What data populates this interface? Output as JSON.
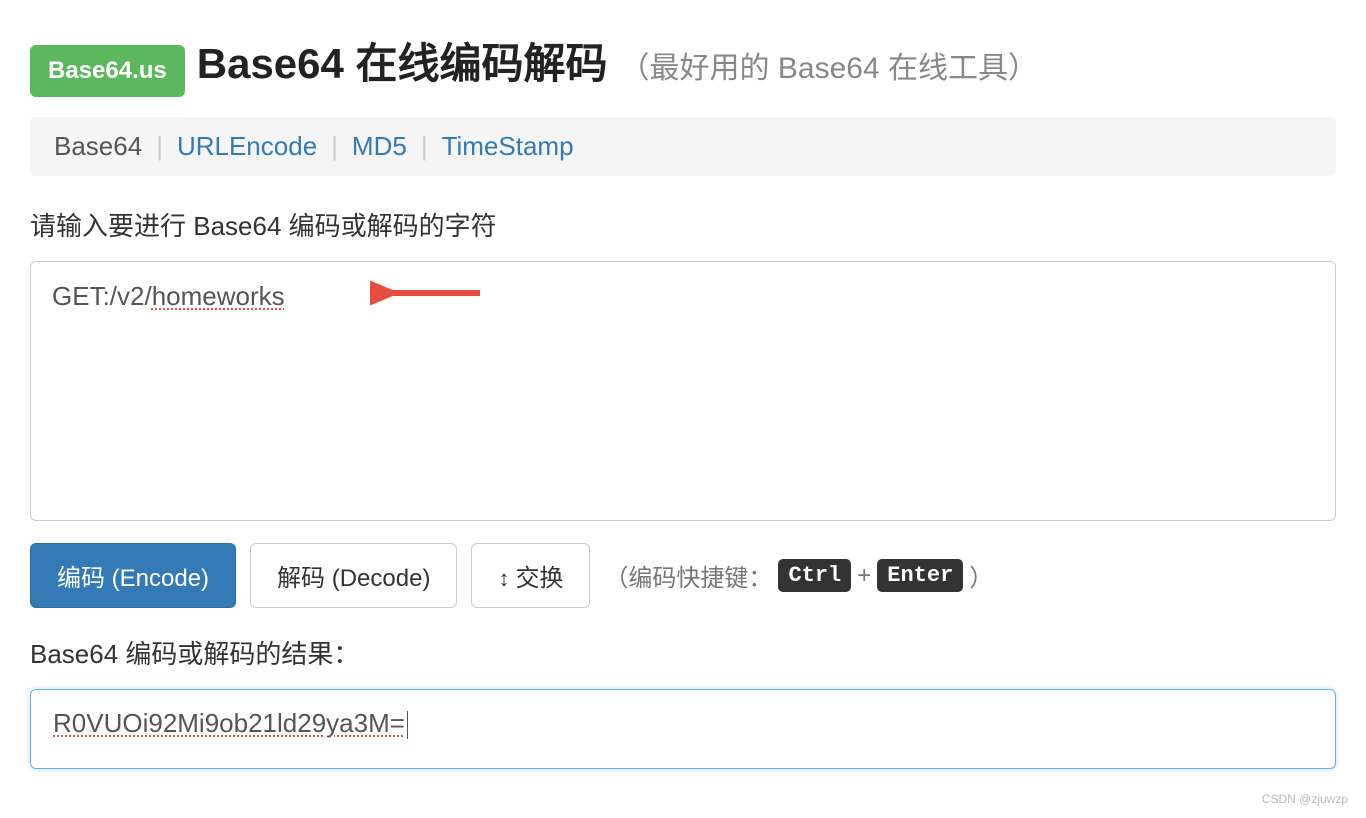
{
  "header": {
    "badge": "Base64.us",
    "title": "Base64 在线编码解码",
    "subtitle": "（最好用的 Base64 在线工具）"
  },
  "nav": {
    "items": [
      {
        "label": "Base64",
        "active": true
      },
      {
        "label": "URLEncode",
        "active": false
      },
      {
        "label": "MD5",
        "active": false
      },
      {
        "label": "TimeStamp",
        "active": false
      }
    ]
  },
  "input_section": {
    "label": "请输入要进行 Base64 编码或解码的字符",
    "value_prefix": "GET:/v2/",
    "value_spellcheck": "homeworks"
  },
  "buttons": {
    "encode": "编码 (Encode)",
    "decode": "解码 (Decode)",
    "swap": "交换",
    "hint_prefix": "（编码快捷键：",
    "kbd1": "Ctrl",
    "plus": "+",
    "kbd2": "Enter",
    "hint_suffix": "）"
  },
  "result_section": {
    "label": "Base64 编码或解码的结果：",
    "value": "R0VUOi92Mi9ob21ld29ya3M="
  },
  "watermark": "CSDN @zjuwzp"
}
